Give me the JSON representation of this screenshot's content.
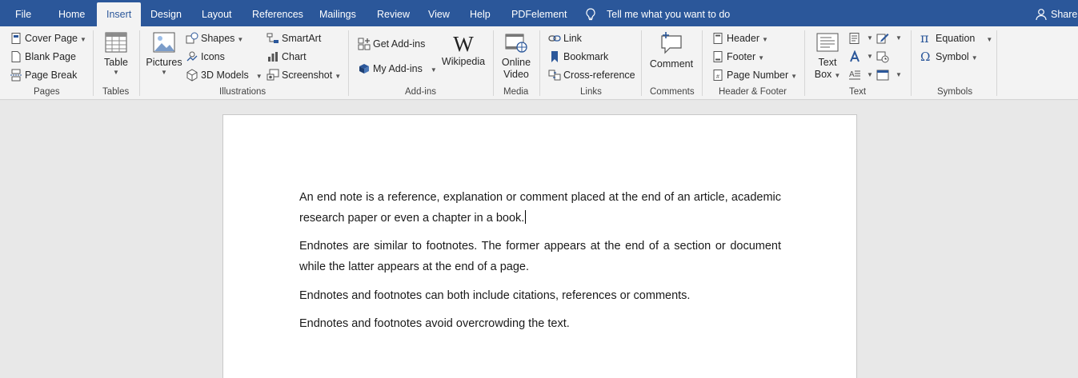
{
  "tabs": [
    {
      "id": "file",
      "label": "File"
    },
    {
      "id": "home",
      "label": "Home"
    },
    {
      "id": "insert",
      "label": "Insert"
    },
    {
      "id": "design",
      "label": "Design"
    },
    {
      "id": "layout",
      "label": "Layout"
    },
    {
      "id": "references",
      "label": "References"
    },
    {
      "id": "mailings",
      "label": "Mailings"
    },
    {
      "id": "review",
      "label": "Review"
    },
    {
      "id": "view",
      "label": "View"
    },
    {
      "id": "help",
      "label": "Help"
    },
    {
      "id": "pdfelement",
      "label": "PDFelement"
    }
  ],
  "active_tab": "Insert",
  "tell_me": "Tell me what you want to do",
  "share": "Share",
  "ribbon": {
    "pages": {
      "label": "Pages",
      "cover_page": "Cover Page",
      "blank_page": "Blank Page",
      "page_break": "Page Break"
    },
    "tables": {
      "label": "Tables",
      "table": "Table"
    },
    "illustrations": {
      "label": "Illustrations",
      "pictures": "Pictures",
      "shapes": "Shapes",
      "icons": "Icons",
      "models_3d": "3D Models",
      "smartart": "SmartArt",
      "chart": "Chart",
      "screenshot": "Screenshot"
    },
    "addins": {
      "label": "Add-ins",
      "get_addins": "Get Add-ins",
      "my_addins": "My Add-ins",
      "wikipedia": "Wikipedia"
    },
    "media": {
      "label": "Media",
      "online_video_1": "Online",
      "online_video_2": "Video"
    },
    "links": {
      "label": "Links",
      "link": "Link",
      "bookmark": "Bookmark",
      "cross_reference": "Cross-reference"
    },
    "comments": {
      "label": "Comments",
      "comment": "Comment"
    },
    "header_footer": {
      "label": "Header & Footer",
      "header": "Header",
      "footer": "Footer",
      "page_number": "Page Number"
    },
    "text": {
      "label": "Text",
      "text_box_1": "Text",
      "text_box_2": "Box"
    },
    "symbols": {
      "label": "Symbols",
      "equation": "Equation",
      "symbol": "Symbol"
    }
  },
  "document": {
    "paragraphs": [
      "An end note is a reference, explanation or comment placed at the end of an article, academic research paper or even a chapter in a book.",
      "Endnotes are similar to footnotes. The former appears at the end of a section or document while the latter appears at the end of a page.",
      "Endnotes and footnotes can both include citations, references or comments.",
      "Endnotes and footnotes avoid overcrowding the text."
    ]
  },
  "colors": {
    "accent": "#2b579a",
    "ribbon_bg": "#f3f3f3",
    "doc_bg": "#e8e8e8"
  }
}
